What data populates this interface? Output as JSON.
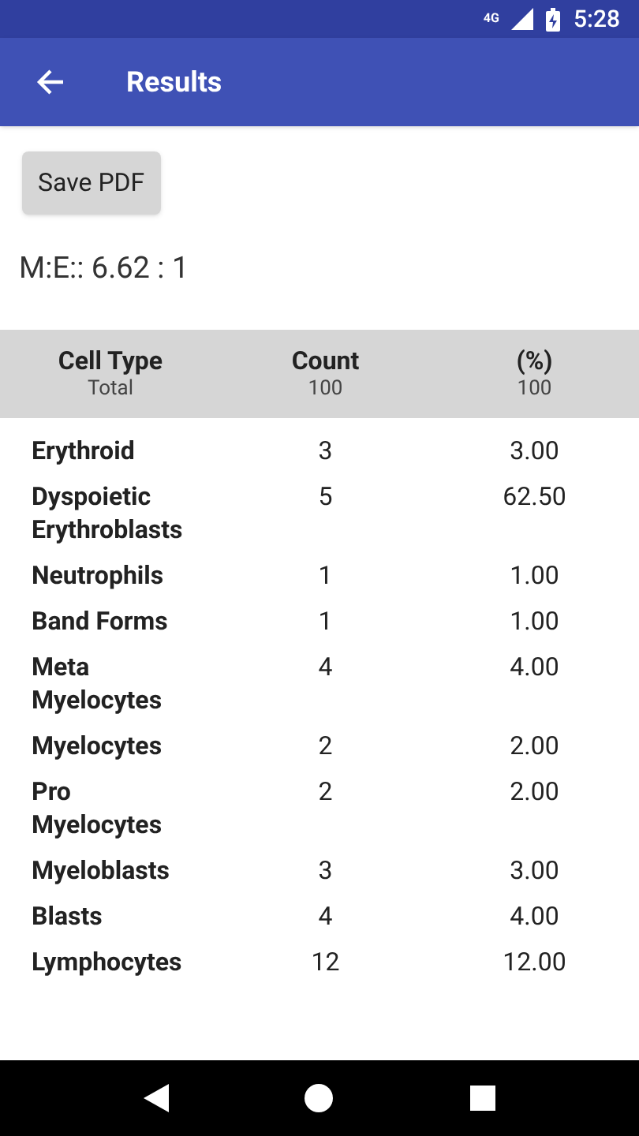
{
  "status_bar": {
    "network": "4G",
    "time": "5:28"
  },
  "app_bar": {
    "title": "Results"
  },
  "save_button": "Save PDF",
  "ratio": "M:E:: 6.62 : 1",
  "table": {
    "columns": [
      {
        "title": "Cell Type",
        "total": "Total"
      },
      {
        "title": "Count",
        "total": "100"
      },
      {
        "title": "(%)",
        "total": "100"
      }
    ],
    "rows": [
      {
        "cell_type": "Erythroid",
        "count": "3",
        "percent": "3.00"
      },
      {
        "cell_type": "Dyspoietic Erythroblasts",
        "count": "5",
        "percent": "62.50"
      },
      {
        "cell_type": "Neutrophils",
        "count": "1",
        "percent": "1.00"
      },
      {
        "cell_type": "Band Forms",
        "count": "1",
        "percent": "1.00"
      },
      {
        "cell_type": "Meta Myelocytes",
        "count": "4",
        "percent": "4.00"
      },
      {
        "cell_type": "Myelocytes",
        "count": "2",
        "percent": "2.00"
      },
      {
        "cell_type": "Pro Myelocytes",
        "count": "2",
        "percent": "2.00"
      },
      {
        "cell_type": "Myeloblasts",
        "count": "3",
        "percent": "3.00"
      },
      {
        "cell_type": "Blasts",
        "count": "4",
        "percent": "4.00"
      },
      {
        "cell_type": "Lymphocytes",
        "count": "12",
        "percent": "12.00"
      }
    ]
  }
}
